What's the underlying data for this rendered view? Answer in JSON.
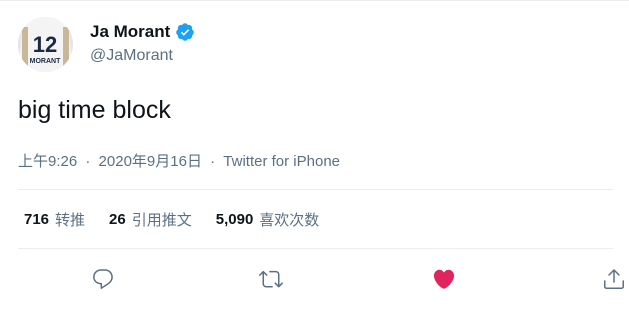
{
  "author": {
    "name": "Ja Morant",
    "handle": "@JaMorant",
    "verified": true,
    "avatar": {
      "jersey_number": "12",
      "jersey_name": "MORANT"
    }
  },
  "tweet": {
    "text": "big time block",
    "time": "上午9:26",
    "separator": "·",
    "date": "2020年9月16日",
    "source": "Twitter for iPhone"
  },
  "stats": [
    {
      "count": "716",
      "label": "转推"
    },
    {
      "count": "26",
      "label": "引用推文"
    },
    {
      "count": "5,090",
      "label": "喜欢次数"
    }
  ],
  "actions": {
    "reply_icon": "reply-icon",
    "retweet_icon": "retweet-icon",
    "like_icon": "heart-icon",
    "share_icon": "share-icon",
    "liked": true
  },
  "colors": {
    "text_primary": "#0f1419",
    "text_secondary": "#5b7083",
    "verified_blue": "#1da1f2",
    "like_red": "#e0245e",
    "divider": "#ebeef0"
  }
}
